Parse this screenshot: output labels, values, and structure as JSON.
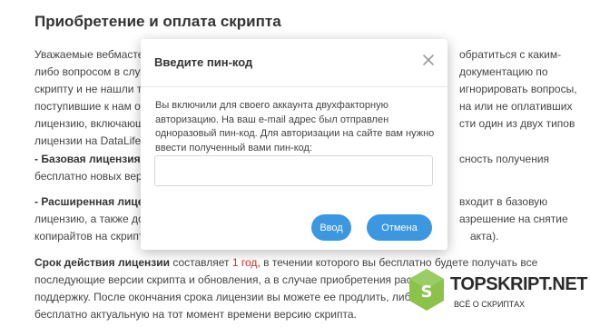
{
  "page": {
    "title": "Приобретение и оплата скрипта",
    "lines": [
      "Уважаемые вебмастер",
      "либо вопросом в служ",
      "скрипту и не нашли та",
      "поступившие к нам от",
      "лицензию, включающ",
      "лицензии на DataLife",
      "обратиться с каким-",
      "документацию по",
      "игнорировать вопросы,",
      "на или не оплативших",
      "сти один из двух типов",
      "сность получения",
      "входит в базовую",
      "азрешение на снятие",
      "акта)."
    ],
    "basic_license_label": "- Базовая лицензия.",
    "basic_license_text": "бесплатно новых верси",
    "extended_license_label": "- Расширенная лицен",
    "extended_license_lines": [
      "лицензию, а также дол",
      "копирайтов на скрипт"
    ],
    "term_label": "Срок действия лицензии",
    "term_text_1": " составляет ",
    "term_value": "1 год",
    "term_text_2": ", в течении которого вы бесплатно будете получать все",
    "term_lines": [
      "последующие версии скрипта и обновления, а в случае приобретения расш",
      "поддержку. После окончания срока лицензии вы можете ее продлить, либо",
      "бесплатно актуальную на тот момент времени версию скрипта."
    ]
  },
  "modal": {
    "title": "Введите пин-код",
    "text": "Вы включили для своего аккаунта двухфакторную авторизацию. На ваш e-mail адрес был отправлен одноразовый пин-код. Для авторизации на сайте вам нужно ввести полученный вами пин-код:",
    "input_value": "",
    "enter_label": "Ввод",
    "cancel_label": "Отмена",
    "close_icon": "close-icon"
  },
  "watermark": {
    "text": "TOPSKRIPT.NET",
    "sub": "ВСЁ О СКРИПТАХ"
  },
  "colors": {
    "accent": "#3b97e0",
    "highlight": "#d9302a",
    "logo_green": "#8bc34a"
  }
}
